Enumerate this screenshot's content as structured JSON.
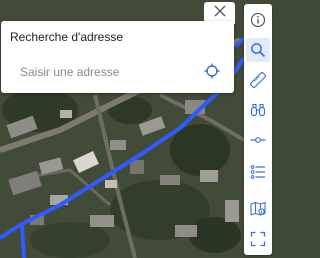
{
  "search_panel": {
    "title": "Recherche d'adresse",
    "placeholder": "Saisir une adresse",
    "value": ""
  },
  "icons": {
    "close": "close-icon",
    "locate": "crosshair-icon"
  },
  "toolbar": {
    "items": [
      {
        "icon": "info-icon",
        "active": false
      },
      {
        "icon": "search-icon",
        "active": true
      },
      {
        "icon": "ruler-icon",
        "active": false
      },
      {
        "icon": "binoculars-icon",
        "active": false
      },
      {
        "icon": "profile-line-icon",
        "active": false
      },
      {
        "icon": "layers-list-icon",
        "active": false
      },
      {
        "icon": "map-legend-icon",
        "active": false
      },
      {
        "icon": "fullscreen-icon",
        "active": false
      }
    ]
  },
  "colors": {
    "accent": "#3b6fd8",
    "route": "#2f5bff",
    "active_bg": "#e2e9f7",
    "panel_bg": "#ffffff"
  }
}
